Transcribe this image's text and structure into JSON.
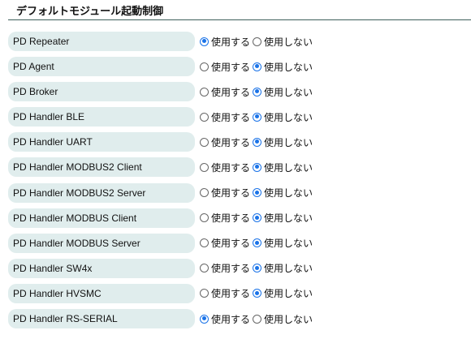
{
  "title": "デフォルトモジュール起動制御",
  "options": {
    "use": "使用する",
    "nouse": "使用しない"
  },
  "accent": "#1a73e8",
  "modules": [
    {
      "name": "PD Repeater",
      "selected": "use"
    },
    {
      "name": "PD Agent",
      "selected": "nouse"
    },
    {
      "name": "PD Broker",
      "selected": "nouse"
    },
    {
      "name": "PD Handler BLE",
      "selected": "nouse"
    },
    {
      "name": "PD Handler UART",
      "selected": "nouse"
    },
    {
      "name": "PD Handler MODBUS2 Client",
      "selected": "nouse"
    },
    {
      "name": "PD Handler MODBUS2 Server",
      "selected": "nouse"
    },
    {
      "name": "PD Handler MODBUS Client",
      "selected": "nouse"
    },
    {
      "name": "PD Handler MODBUS Server",
      "selected": "nouse"
    },
    {
      "name": "PD Handler SW4x",
      "selected": "nouse"
    },
    {
      "name": "PD Handler HVSMC",
      "selected": "nouse"
    },
    {
      "name": "PD Handler RS-SERIAL",
      "selected": "use"
    }
  ]
}
